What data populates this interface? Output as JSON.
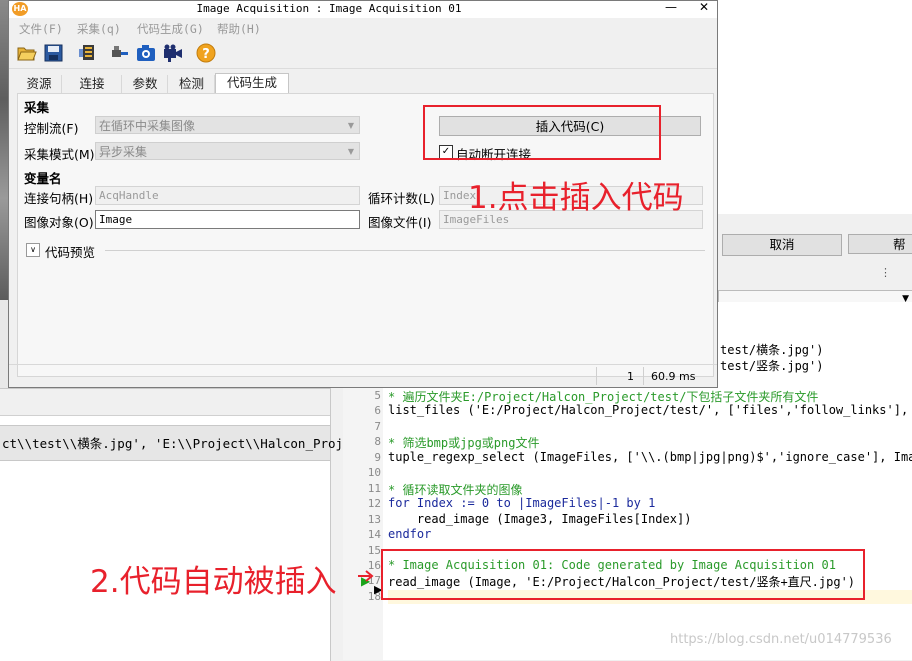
{
  "dialog": {
    "title": "Image Acquisition : Image Acquisition 01",
    "app_icon": "HA",
    "menu": [
      "文件(F)",
      "采集(q)",
      "代码生成(G)",
      "帮助(H)"
    ],
    "tabs": [
      "资源",
      "连接",
      "参数",
      "检测",
      "代码生成"
    ],
    "active_tab": "代码生成",
    "acquisition_section": "采集",
    "control_flow_label": "控制流(F)",
    "control_flow_value": "在循环中采集图像",
    "acq_mode_label": "采集模式(M)",
    "acq_mode_value": "异步采集",
    "insert_code_button": "插入代码(C)",
    "auto_disconnect_label": "自动断开连接",
    "auto_disconnect_checked": true,
    "variables_section": "变量名",
    "handle_label": "连接句柄(H)",
    "handle_value": "AcqHandle",
    "loop_counter_label": "循环计数(L)",
    "loop_counter_value": "Index",
    "image_object_label": "图像对象(O)",
    "image_object_value": "Image",
    "image_files_label": "图像文件(I)",
    "image_files_value": "ImageFiles",
    "code_preview_label": "代码预览",
    "status_count": "1",
    "status_time": "60.9 ms"
  },
  "background": {
    "cancel_button": "取消",
    "help_button": "帮",
    "variable_path_text": "ct\\\\test\\\\横条.jpg', 'E:\\\\Project\\\\Halcon_Proj…"
  },
  "editor": {
    "partial_lines": [
      {
        "text": "test/横条.jpg')"
      },
      {
        "text": "test/竖条.jpg')"
      }
    ],
    "lines": [
      {
        "n": "5",
        "kind": "cmt",
        "text": "* 遍历文件夹E:/Project/Halcon_Project/test/下包括子文件夹所有文件"
      },
      {
        "n": "6",
        "kind": "code",
        "text": "list_files ('E:/Project/Halcon_Project/test/', ['files','follow_links'], Im"
      },
      {
        "n": "7",
        "kind": "blank",
        "text": ""
      },
      {
        "n": "8",
        "kind": "cmt",
        "text": "* 筛选bmp或jpg或png文件"
      },
      {
        "n": "9",
        "kind": "code",
        "text": "tuple_regexp_select (ImageFiles, ['\\\\.(bmp|jpg|png)$','ignore_case'], Image"
      },
      {
        "n": "10",
        "kind": "blank",
        "text": ""
      },
      {
        "n": "11",
        "kind": "cmt",
        "text": "* 循环读取文件夹的图像"
      },
      {
        "n": "12",
        "kind": "kw",
        "text": "for Index := 0 to |ImageFiles|-1 by 1"
      },
      {
        "n": "13",
        "kind": "code",
        "text": "    read_image (Image3, ImageFiles[Index])"
      },
      {
        "n": "14",
        "kind": "kw",
        "text": "endfor"
      },
      {
        "n": "15",
        "kind": "blank",
        "text": ""
      },
      {
        "n": "16",
        "kind": "cmt",
        "text": "* Image Acquisition 01: Code generated by Image Acquisition 01"
      },
      {
        "n": "17",
        "kind": "code",
        "text": "read_image (Image, 'E:/Project/Halcon_Project/test/竖条+直尺.jpg')"
      },
      {
        "n": "18",
        "kind": "blank",
        "text": ""
      }
    ]
  },
  "annotations": {
    "note1": "1.点击插入代码",
    "note2": "2.代码自动被插入"
  },
  "watermark": "https://blog.csdn.net/u014779536",
  "colors": {
    "annotation_red": "#e8212c",
    "comment_green": "#2a9a2a",
    "keyword_blue": "#1b2a9c"
  }
}
